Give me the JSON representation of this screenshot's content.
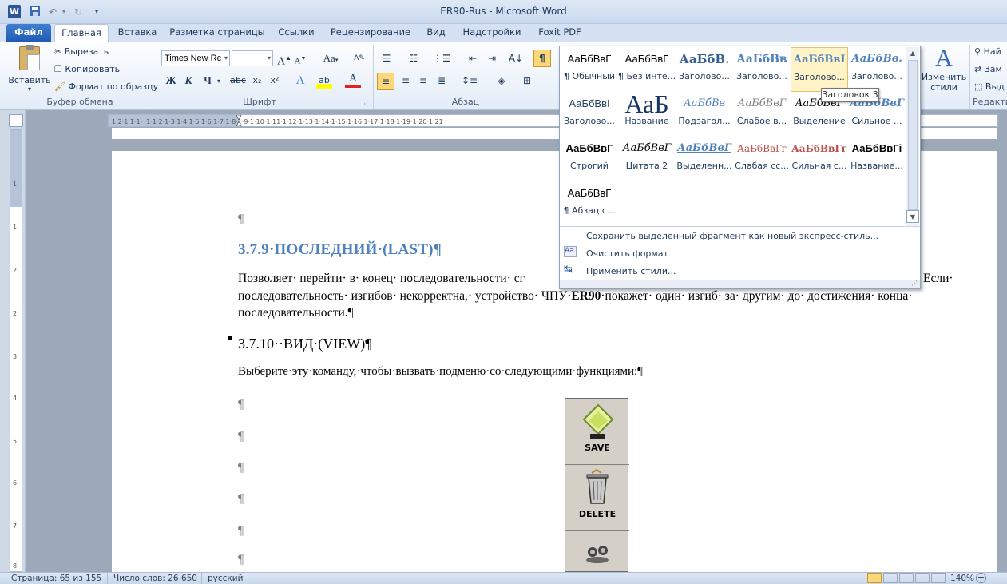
{
  "window": {
    "title": "ER90-Rus  -  Microsoft Word"
  },
  "quick_access": {
    "word_icon": "W",
    "save_icon": "save-icon",
    "undo_icon": "undo-icon",
    "redo_icon": "redo-icon",
    "customize_icon": "customize-icon"
  },
  "tabs": [
    {
      "label": "Файл"
    },
    {
      "label": "Главная"
    },
    {
      "label": "Вставка"
    },
    {
      "label": "Разметка страницы"
    },
    {
      "label": "Ссылки"
    },
    {
      "label": "Рецензирование"
    },
    {
      "label": "Вид"
    },
    {
      "label": "Надстройки"
    },
    {
      "label": "Foxit PDF"
    }
  ],
  "ribbon": {
    "clipboard": {
      "paste": "Вставить",
      "cut": "Вырезать",
      "copy": "Копировать",
      "format_painter": "Формат по образцу",
      "group": "Буфер обмена"
    },
    "font": {
      "family": "Times New Rc",
      "size": "",
      "group": "Шрифт",
      "bold": "Ж",
      "italic": "К",
      "underline": "Ч",
      "strike": "abc",
      "sub": "x₂",
      "sup": "x²",
      "grow": "A",
      "shrink": "A",
      "case": "Aa",
      "color": "A",
      "highlight": "ab"
    },
    "paragraph": {
      "group": "Абзац",
      "pilcrow": "¶"
    },
    "styles": {
      "change": "Изменить",
      "change2": "стили"
    },
    "editing": {
      "find": "Най",
      "replace": "Зам",
      "select": "Выд",
      "group": "Редакти"
    }
  },
  "gallery": {
    "rows": [
      [
        {
          "preview": "АаБбВвГ",
          "label": "¶ Обычный",
          "style": "normal"
        },
        {
          "preview": "АаБбВвГ",
          "label": "¶ Без инте...",
          "style": "normal"
        },
        {
          "preview": "АаБбВ.",
          "label": "Заголово...",
          "style": "h1"
        },
        {
          "preview": "АаБбВв",
          "label": "Заголово...",
          "style": "h2"
        },
        {
          "preview": "АаБбВвІ",
          "label": "Заголово...",
          "style": "h3"
        },
        {
          "preview": "АаБбВв.",
          "label": "Заголово...",
          "style": "h4"
        }
      ],
      [
        {
          "preview": "АаБбВвІ",
          "label": "Заголово...",
          "style": "h5"
        },
        {
          "preview": "АаБ",
          "label": "Название",
          "style": "title"
        },
        {
          "preview": "АаБбВв",
          "label": "Подзагол...",
          "style": "subtitle"
        },
        {
          "preview": "АаБбВвГ",
          "label": "Слабое в...",
          "style": "weak"
        },
        {
          "preview": "АаБбВвГ",
          "label": "Выделение",
          "style": "emph"
        },
        {
          "preview": "АаБбВвГ",
          "label": "Сильное ...",
          "style": "strongemph"
        }
      ],
      [
        {
          "preview": "АаБбВвГ",
          "label": "Строгий",
          "style": "strict"
        },
        {
          "preview": "АаБбВвГ",
          "label": "Цитата 2",
          "style": "quote"
        },
        {
          "preview": "АаБбВвГ",
          "label": "Выделенн...",
          "style": "intensequote"
        },
        {
          "preview": "АаБбВвГг",
          "label": "Слабая сс...",
          "style": "weakref"
        },
        {
          "preview": "АаБбВвГг",
          "label": "Сильная с...",
          "style": "strongref"
        },
        {
          "preview": "АаБбВвГі",
          "label": "Название...",
          "style": "booktitle"
        }
      ],
      [
        {
          "preview": "АаБбВвГ",
          "label": "¶ Абзац с...",
          "style": "normal"
        }
      ]
    ],
    "tooltip": "Заголовок 3",
    "menu": [
      {
        "label": "Сохранить выделенный фрагмент как новый экспресс-стиль...",
        "icon": ""
      },
      {
        "label": "Очистить формат",
        "icon": "clear-format-icon"
      },
      {
        "label": "Применить стили...",
        "icon": "apply-styles-icon"
      }
    ]
  },
  "document": {
    "heading1": "3.7.9·ПОСЛЕДНИЙ·(LAST)¶",
    "p1_line1_left": "Позволяет· перейти· в· конец· последовательности· сг",
    "p1_line1_right": "Если·",
    "p1_line2_a": "последовательность· изгибов· некорректна,· устройство· ЧПУ·",
    "p1_line2_bold": "ER90",
    "p1_line2_b": "·покажет· один· изгиб· за· другим· до· достижения· конца·",
    "p1_line3": "последовательности.¶",
    "heading2": "3.7.10··ВИД·(VIEW)¶",
    "p2": "Выберите·эту·команду,·чтобы·вызвать·подменю·со·следующими·функциями:¶",
    "pilcrow": "¶",
    "tools": [
      {
        "label": "SAVE"
      },
      {
        "label": "DELETE"
      },
      {
        "label": ""
      }
    ]
  },
  "statusbar": {
    "page": "Страница: 65 из 155",
    "words": "Число слов: 26 650",
    "lang": "русский",
    "zoom": "140%"
  }
}
